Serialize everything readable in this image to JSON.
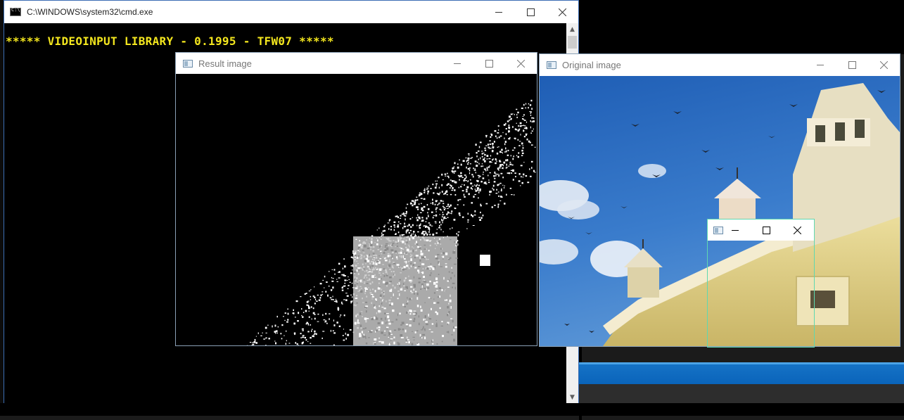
{
  "console_window": {
    "title": "C:\\WINDOWS\\system32\\cmd.exe",
    "output_line": "***** VIDEOINPUT LIBRARY - 0.1995 - TFW07 *****"
  },
  "result_window": {
    "title": "Result image"
  },
  "original_window": {
    "title": "Original image"
  },
  "small_window": {
    "title": ""
  },
  "icons": {
    "minimize": "minimize-icon",
    "maximize": "maximize-icon",
    "close": "close-icon"
  },
  "colors": {
    "console_text": "#f3e61e",
    "console_bg": "#000000",
    "sky": "#2f6fc1",
    "building": "#e6d68a",
    "accent_border": "#5fd8b0"
  }
}
